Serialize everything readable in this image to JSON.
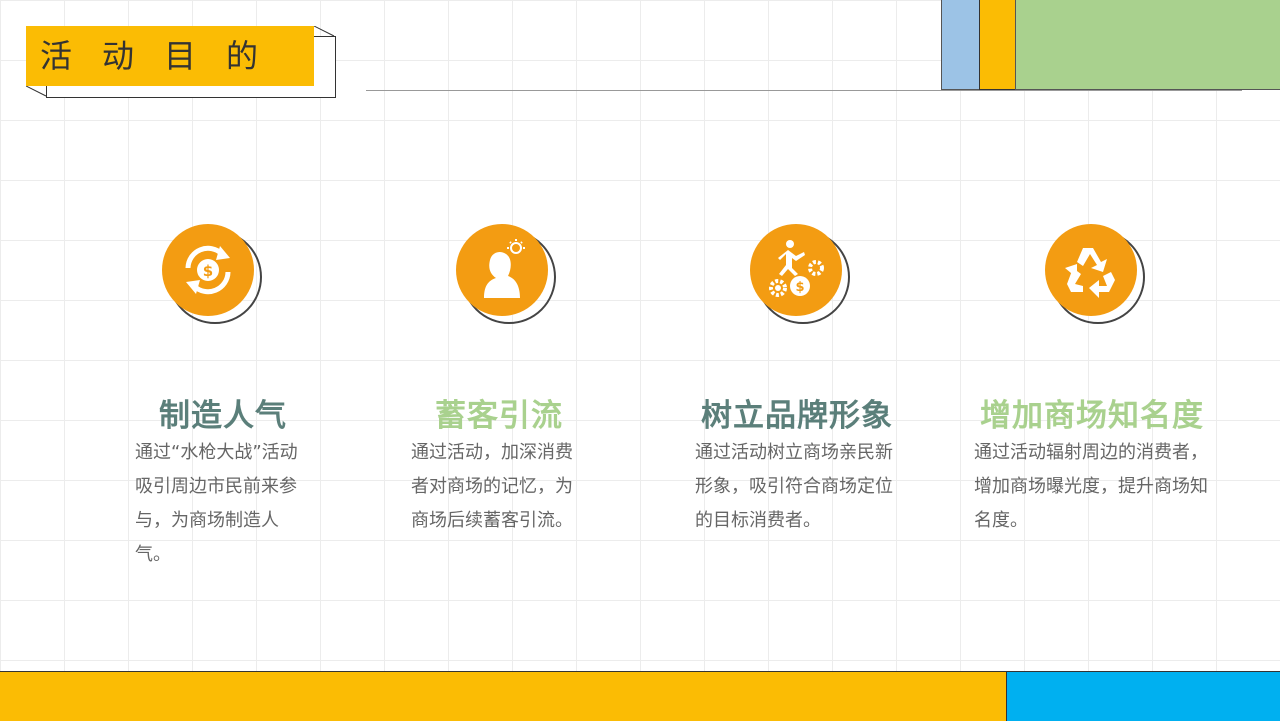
{
  "header": {
    "title": "活动目的"
  },
  "colors": {
    "accent_yellow": "#fbbc04",
    "accent_orange": "#f39c12",
    "block_blue": "#9cc3e6",
    "block_green": "#a9d18e",
    "footer_blue": "#00b0f0",
    "title_dark": "#5b7f7a",
    "title_green": "#a9d18e"
  },
  "cards": [
    {
      "icon": "money-cycle-icon",
      "title": "制造人气",
      "title_color": "#5b7f7a",
      "description": "通过“水枪大战”活动吸引周边市民前来参与，为商场制造人气。"
    },
    {
      "icon": "person-idea-icon",
      "title": "蓄客引流",
      "title_color": "#a9d18e",
      "description": "通过活动，加深消费者对商场的记忆，为商场后续蓄客引流。"
    },
    {
      "icon": "climber-gears-icon",
      "title": "树立品牌形象",
      "title_color": "#5b7f7a",
      "description": "通过活动树立商场亲民新形象，吸引符合商场定位的目标消费者。"
    },
    {
      "icon": "recycle-icon",
      "title": "增加商场知名度",
      "title_color": "#a9d18e",
      "description": "通过活动辐射周边的消费者，增加商场曝光度，提升商场知名度。"
    }
  ]
}
